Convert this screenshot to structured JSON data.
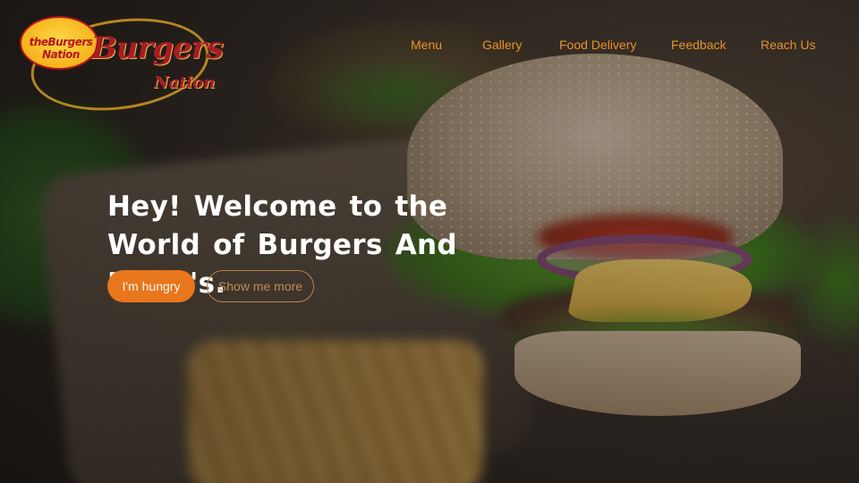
{
  "brand": {
    "badge_text": "theBurgers Nation",
    "logo_title": "Burgers",
    "logo_subtitle": "Nation"
  },
  "nav": {
    "items": [
      "Menu",
      "Gallery",
      "Food Delivery",
      "Feedback",
      "Reach Us"
    ]
  },
  "hero": {
    "headline": "Hey! Welcome to the World of Burgers And Pizza's.",
    "primary_button": "I'm hungry",
    "secondary_button": "Show me more",
    "background": "burger-and-fries-photo"
  },
  "colors": {
    "accent": "#e8761d",
    "nav_text": "#e8912a",
    "headline": "#ffffff",
    "outline_button_text": "#c28a55",
    "logo_red": "#a71d23",
    "logo_yellow": "#f5b21c"
  }
}
